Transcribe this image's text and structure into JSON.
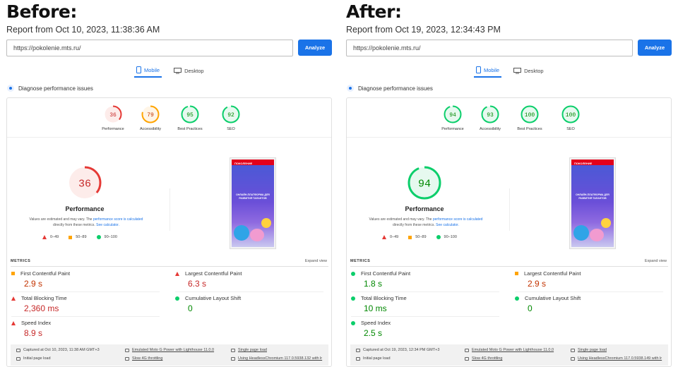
{
  "colors": {
    "red": "#e53935",
    "orange": "#ffa400",
    "green": "#0cce6b",
    "accent": "#1a73e8"
  },
  "panels": [
    {
      "heading": "Before:",
      "report": "Report from Oct 10, 2023, 11:38:36 AM",
      "url": "https://pokolenie.mts.ru/",
      "analyze": "Analyze",
      "tabs": [
        {
          "label": "Mobile",
          "icon": "mobile-icon"
        },
        {
          "label": "Desktop",
          "icon": "desktop-icon"
        }
      ],
      "diagnose": "Diagnose performance issues",
      "scores": [
        {
          "value": "36",
          "label": "Performance",
          "status": "red"
        },
        {
          "value": "79",
          "label": "Accessibility",
          "status": "orange"
        },
        {
          "value": "95",
          "label": "Best Practices",
          "status": "green"
        },
        {
          "value": "92",
          "label": "SEO",
          "status": "green"
        }
      ],
      "main_score": {
        "value": "36",
        "label": "Performance",
        "status": "red"
      },
      "estimate": {
        "pre": "Values are estimated and may vary. The ",
        "link": "performance score is calculated",
        "mid": " directly from these metrics. ",
        "link2": "See calculator."
      },
      "legend": [
        "0–49",
        "50–89",
        "90–100"
      ],
      "screenshot": {
        "logo": "ПОКОЛЕНИЕ",
        "headline": "ОНЛАЙН-ПЛАТФОРМА ДЛЯ РАЗВИТИЯ ТАЛАНТОВ"
      },
      "metrics_title": "METRICS",
      "expand": "Expand view",
      "metrics": [
        {
          "name": "First Contentful Paint",
          "value": "2.9 s",
          "status": "orange"
        },
        {
          "name": "Largest Contentful Paint",
          "value": "6.3 s",
          "status": "red"
        },
        {
          "name": "Total Blocking Time",
          "value": "2,360 ms",
          "status": "red"
        },
        {
          "name": "Cumulative Layout Shift",
          "value": "0",
          "status": "green"
        },
        {
          "name": "Speed Index",
          "value": "8.9 s",
          "status": "red"
        }
      ],
      "footer": {
        "captured": "Captured at Oct 10, 2023, 11:38 AM GMT+3",
        "device": "Emulated Moto G Power with Lighthouse 11.0.0",
        "session": "Single page load",
        "initial": "Initial page load",
        "throttle": "Slow 4G throttling",
        "browser": "Using HeadlessChromium 117.0.5938.132 with lr"
      }
    },
    {
      "heading": "After:",
      "report": "Report from Oct 19, 2023, 12:34:43 PM",
      "url": "https://pokolenie.mts.ru/",
      "analyze": "Analyze",
      "tabs": [
        {
          "label": "Mobile",
          "icon": "mobile-icon"
        },
        {
          "label": "Desktop",
          "icon": "desktop-icon"
        }
      ],
      "diagnose": "Diagnose performance issues",
      "scores": [
        {
          "value": "94",
          "label": "Performance",
          "status": "green"
        },
        {
          "value": "93",
          "label": "Accessibility",
          "status": "green"
        },
        {
          "value": "100",
          "label": "Best Practices",
          "status": "green"
        },
        {
          "value": "100",
          "label": "SEO",
          "status": "green"
        }
      ],
      "main_score": {
        "value": "94",
        "label": "Performance",
        "status": "green"
      },
      "estimate": {
        "pre": "Values are estimated and may vary. The ",
        "link": "performance score is calculated",
        "mid": " directly from these metrics. ",
        "link2": "See calculator."
      },
      "legend": [
        "0–49",
        "50–89",
        "90–100"
      ],
      "screenshot": {
        "logo": "ПОКОЛЕНИЕ",
        "headline": "ОНЛАЙН-ПЛАТФОРМА ДЛЯ РАЗВИТИЯ ТАЛАНТОВ"
      },
      "metrics_title": "METRICS",
      "expand": "Expand view",
      "metrics": [
        {
          "name": "First Contentful Paint",
          "value": "1.8 s",
          "status": "green"
        },
        {
          "name": "Largest Contentful Paint",
          "value": "2.9 s",
          "status": "orange"
        },
        {
          "name": "Total Blocking Time",
          "value": "10 ms",
          "status": "green"
        },
        {
          "name": "Cumulative Layout Shift",
          "value": "0",
          "status": "green"
        },
        {
          "name": "Speed Index",
          "value": "2.5 s",
          "status": "green"
        }
      ],
      "footer": {
        "captured": "Captured at Oct 19, 2023, 12:34 PM GMT+3",
        "device": "Emulated Moto G Power with Lighthouse 11.0.0",
        "session": "Single page load",
        "initial": "Initial page load",
        "throttle": "Slow 4G throttling",
        "browser": "Using HeadlessChromium 117.0.5938.149 with lr"
      }
    }
  ]
}
